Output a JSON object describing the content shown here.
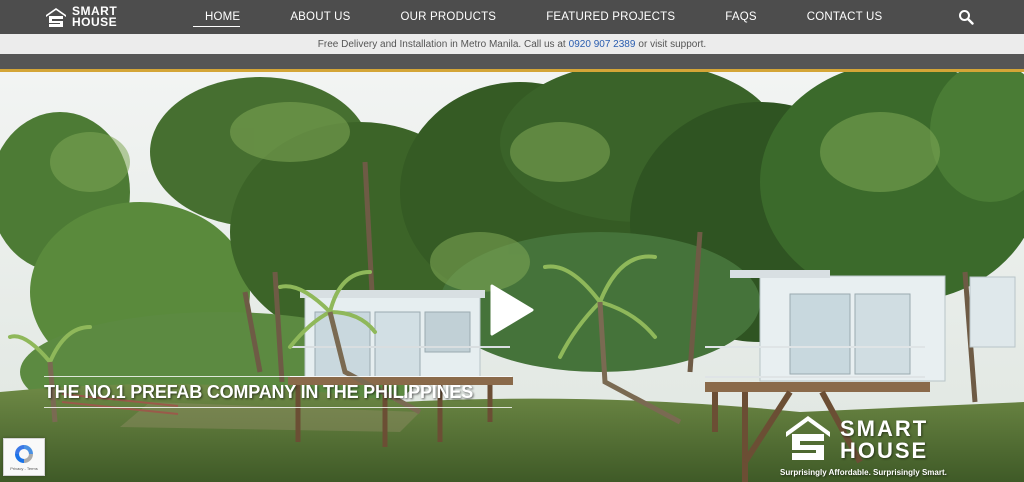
{
  "header": {
    "logo_line1": "SMART",
    "logo_line2": "HOUSE",
    "nav": [
      {
        "label": "HOME"
      },
      {
        "label": "ABOUT US"
      },
      {
        "label": "OUR PRODUCTS"
      },
      {
        "label": "FEATURED PROJECTS"
      },
      {
        "label": "FAQS"
      },
      {
        "label": "CONTACT US"
      }
    ],
    "active_nav": "HOME",
    "search_icon": "search-icon"
  },
  "promo": {
    "text_before": "Free Delivery and Installation in Metro Manila. Call us at",
    "phone": "0920 907 2389",
    "text_after": "or visit support."
  },
  "hero": {
    "tagline": "THE NO.1 PREFAB COMPANY IN THE PHILIPPINES",
    "play_icon": "play-icon",
    "watermark_line1": "SMART",
    "watermark_line2": "HOUSE",
    "watermark_slogan": "Surprisingly Affordable. Surprisingly Smart."
  },
  "recaptcha": {
    "terms": "Privacy - Terms"
  },
  "colors": {
    "nav_bg": "#4d4d4d",
    "promo_bg": "#ececec",
    "accent_gold": "#d4a537",
    "link_blue": "#2a5db0"
  }
}
